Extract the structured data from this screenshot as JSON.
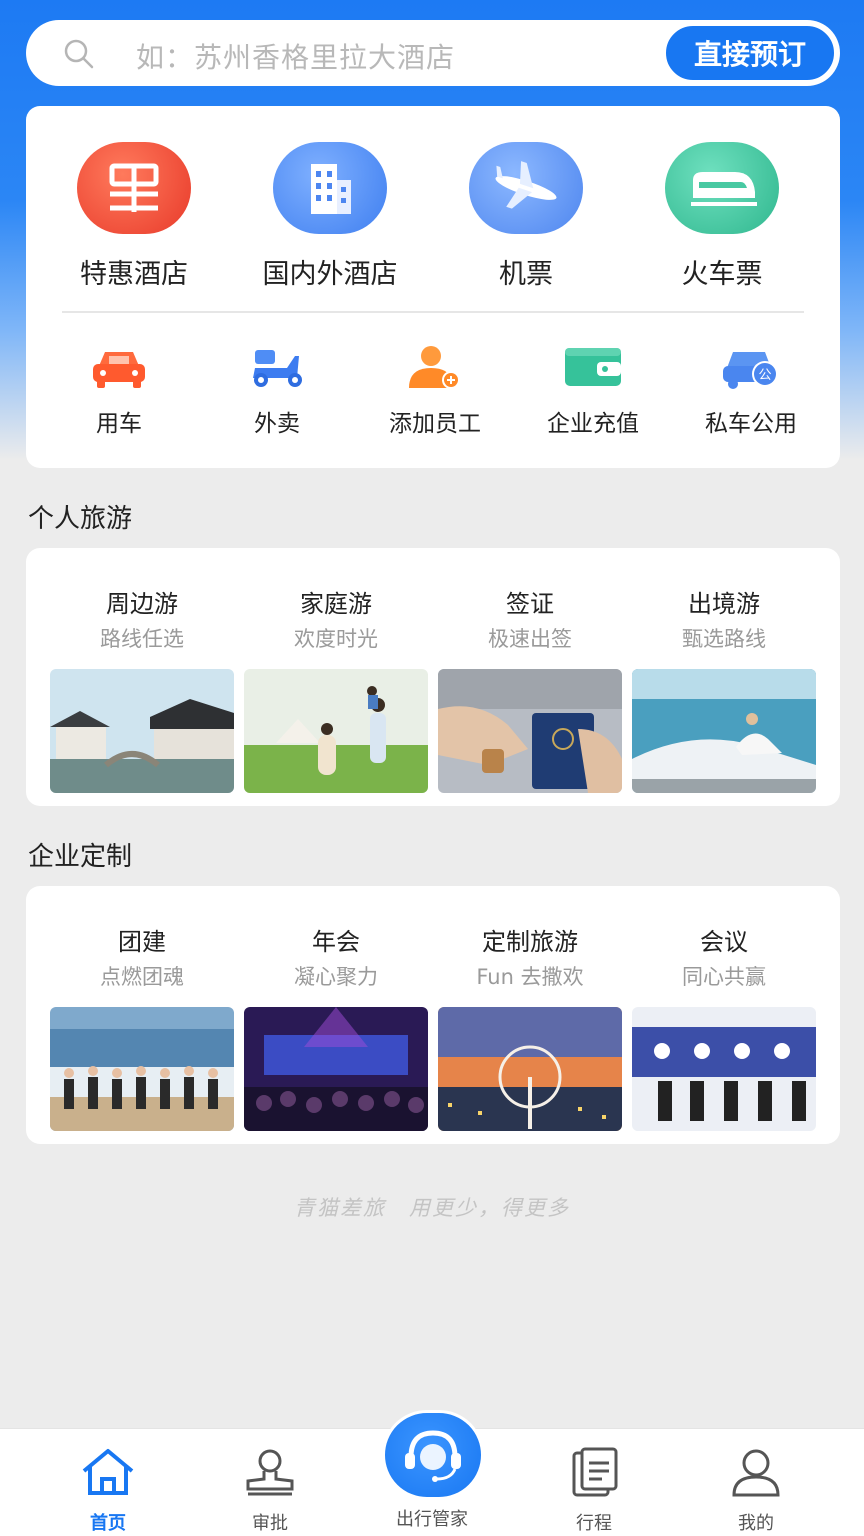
{
  "search": {
    "placeholder": "如：苏州香格里拉大酒店",
    "button": "直接预订"
  },
  "main_services": [
    {
      "label": "特惠酒店",
      "icon": "discount-hotel-icon"
    },
    {
      "label": "国内外酒店",
      "icon": "hotel-building-icon"
    },
    {
      "label": "机票",
      "icon": "airplane-icon"
    },
    {
      "label": "火车票",
      "icon": "train-icon"
    }
  ],
  "sub_services": [
    {
      "label": "用车",
      "icon": "car-icon"
    },
    {
      "label": "外卖",
      "icon": "scooter-icon"
    },
    {
      "label": "添加员工",
      "icon": "add-employee-icon"
    },
    {
      "label": "企业充值",
      "icon": "wallet-icon"
    },
    {
      "label": "私车公用",
      "icon": "private-car-public-icon"
    }
  ],
  "personal_travel": {
    "title": "个人旅游",
    "items": [
      {
        "title": "周边游",
        "sub": "路线任选"
      },
      {
        "title": "家庭游",
        "sub": "欢度时光"
      },
      {
        "title": "签证",
        "sub": "极速出签"
      },
      {
        "title": "出境游",
        "sub": "甄选路线"
      }
    ]
  },
  "enterprise": {
    "title": "企业定制",
    "items": [
      {
        "title": "团建",
        "sub": "点燃团魂"
      },
      {
        "title": "年会",
        "sub": "凝心聚力"
      },
      {
        "title": "定制旅游",
        "sub": "Fun 去撒欢"
      },
      {
        "title": "会议",
        "sub": "同心共赢"
      }
    ]
  },
  "slogan": "青猫差旅　用更少，得更多",
  "tabbar": {
    "home": "首页",
    "approve": "审批",
    "butler": "出行管家",
    "trips": "行程",
    "mine": "我的"
  },
  "colors": {
    "accent": "#1877f2",
    "hotel_red": "#f04a36",
    "train_green": "#36c29a"
  }
}
